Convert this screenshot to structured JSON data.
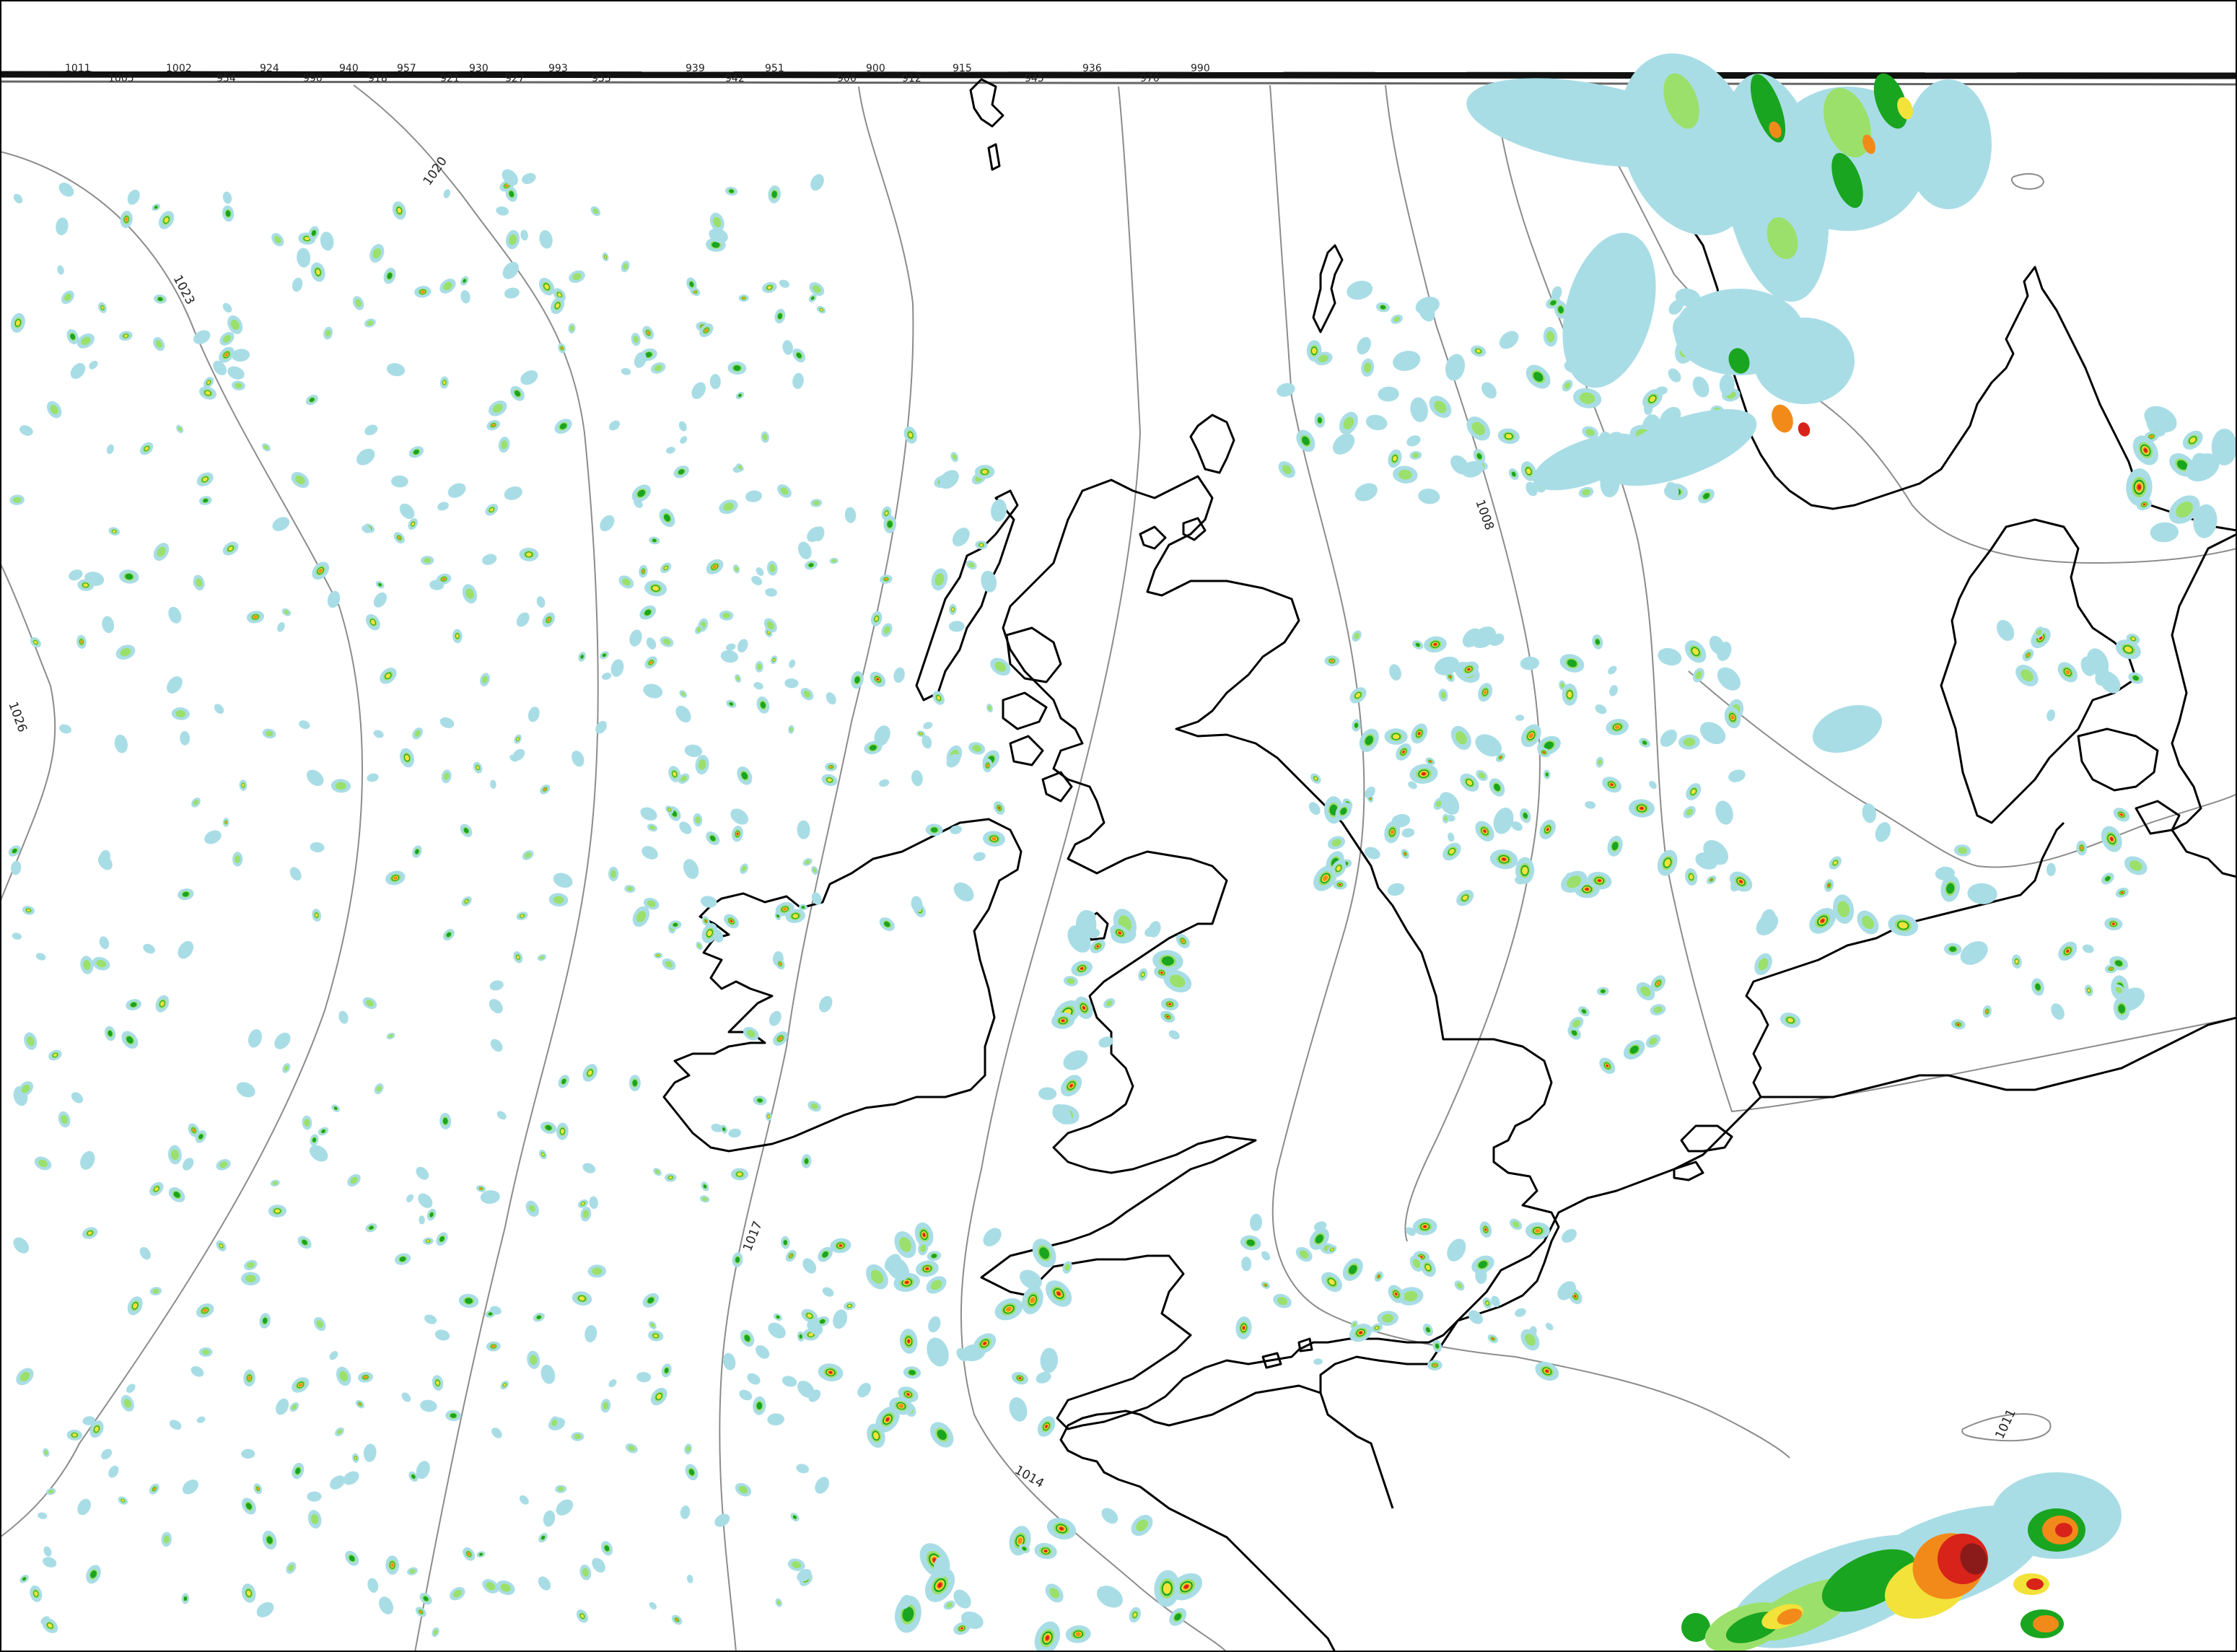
{
  "map": {
    "type": "precipitation-and-isobar-chart",
    "region": "British Isles and North Sea",
    "isobar_labels": [
      {
        "id": "i1020",
        "text": "1020"
      },
      {
        "id": "i1023",
        "text": "1023"
      },
      {
        "id": "i1026",
        "text": "1026"
      },
      {
        "id": "i1017",
        "text": "1017"
      },
      {
        "id": "i1014",
        "text": "1014"
      },
      {
        "id": "i1008",
        "text": "1008"
      },
      {
        "id": "i1011",
        "text": "1011"
      }
    ],
    "top_edge_labels": [
      "1011",
      "1005",
      "1002",
      "954",
      "924",
      "990",
      "940",
      "918",
      "957",
      "921",
      "930",
      "927",
      "993",
      "933",
      "939",
      "942",
      "951",
      "906",
      "900",
      "912",
      "915",
      "945",
      "936",
      "970",
      "990"
    ],
    "precip_colors": {
      "light": "#a9dde6",
      "moderate": "#9be06a",
      "green": "#1aa520",
      "yellow": "#f2e23a",
      "orange": "#f28a1a",
      "red": "#d8231a",
      "dark": "#8b1a1a"
    },
    "isobar_color": "#8c8c8c",
    "coastline_color": "#000000"
  }
}
